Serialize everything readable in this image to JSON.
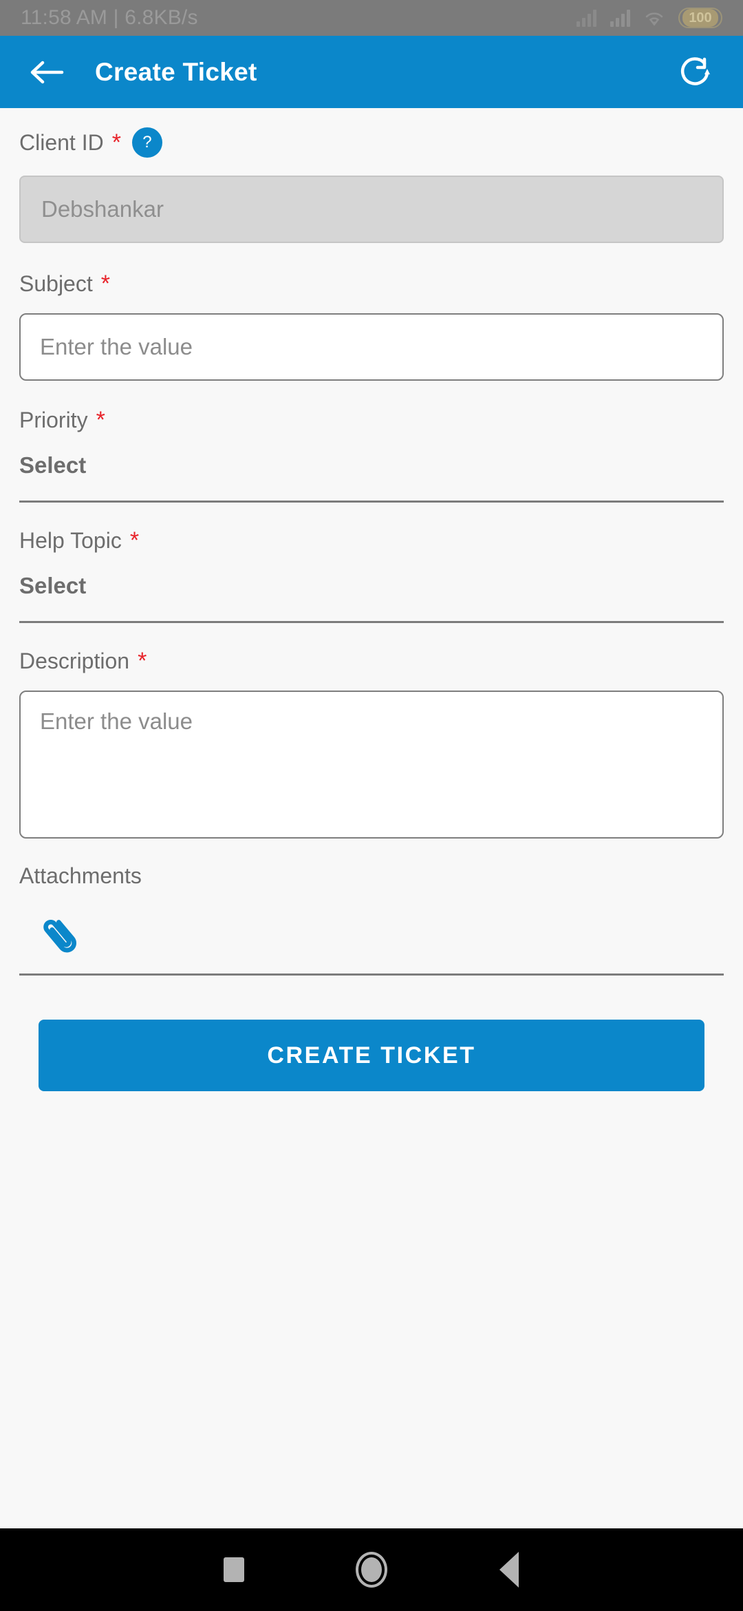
{
  "status_bar": {
    "clock": "11:58 AM | 6.8KB/s",
    "battery_level": "100",
    "icons": [
      "signal-icon",
      "signal-icon",
      "wifi-icon",
      "battery-icon"
    ]
  },
  "app_bar": {
    "title": "Create Ticket",
    "back_icon": "arrow-left-icon",
    "refresh_icon": "refresh-icon",
    "background_color": "#0b87ca"
  },
  "form": {
    "client_id": {
      "label": "Client ID",
      "required_marker": "*",
      "help_glyph": "?",
      "value": "Debshankar",
      "disabled": true
    },
    "subject": {
      "label": "Subject",
      "required_marker": "*",
      "placeholder": "Enter the value",
      "value": ""
    },
    "priority": {
      "label": "Priority",
      "required_marker": "*",
      "selected": "Select"
    },
    "help_topic": {
      "label": "Help Topic",
      "required_marker": "*",
      "selected": "Select"
    },
    "description": {
      "label": "Description",
      "required_marker": "*",
      "placeholder": "Enter the value",
      "value": ""
    },
    "attachments": {
      "label": "Attachments",
      "icon": "paperclip-icon",
      "icon_color": "#0b87ca"
    }
  },
  "submit": {
    "label": "CREATE TICKET",
    "color": "#0b87ca"
  },
  "nav_bar": {
    "recents_icon": "square-icon",
    "home_icon": "circle-icon",
    "back_icon": "triangle-back-icon"
  },
  "colors": {
    "accent": "#0b87ca",
    "required": "#e8232a",
    "page_bg": "#f8f8f8",
    "disabled_bg": "#d6d6d6"
  }
}
